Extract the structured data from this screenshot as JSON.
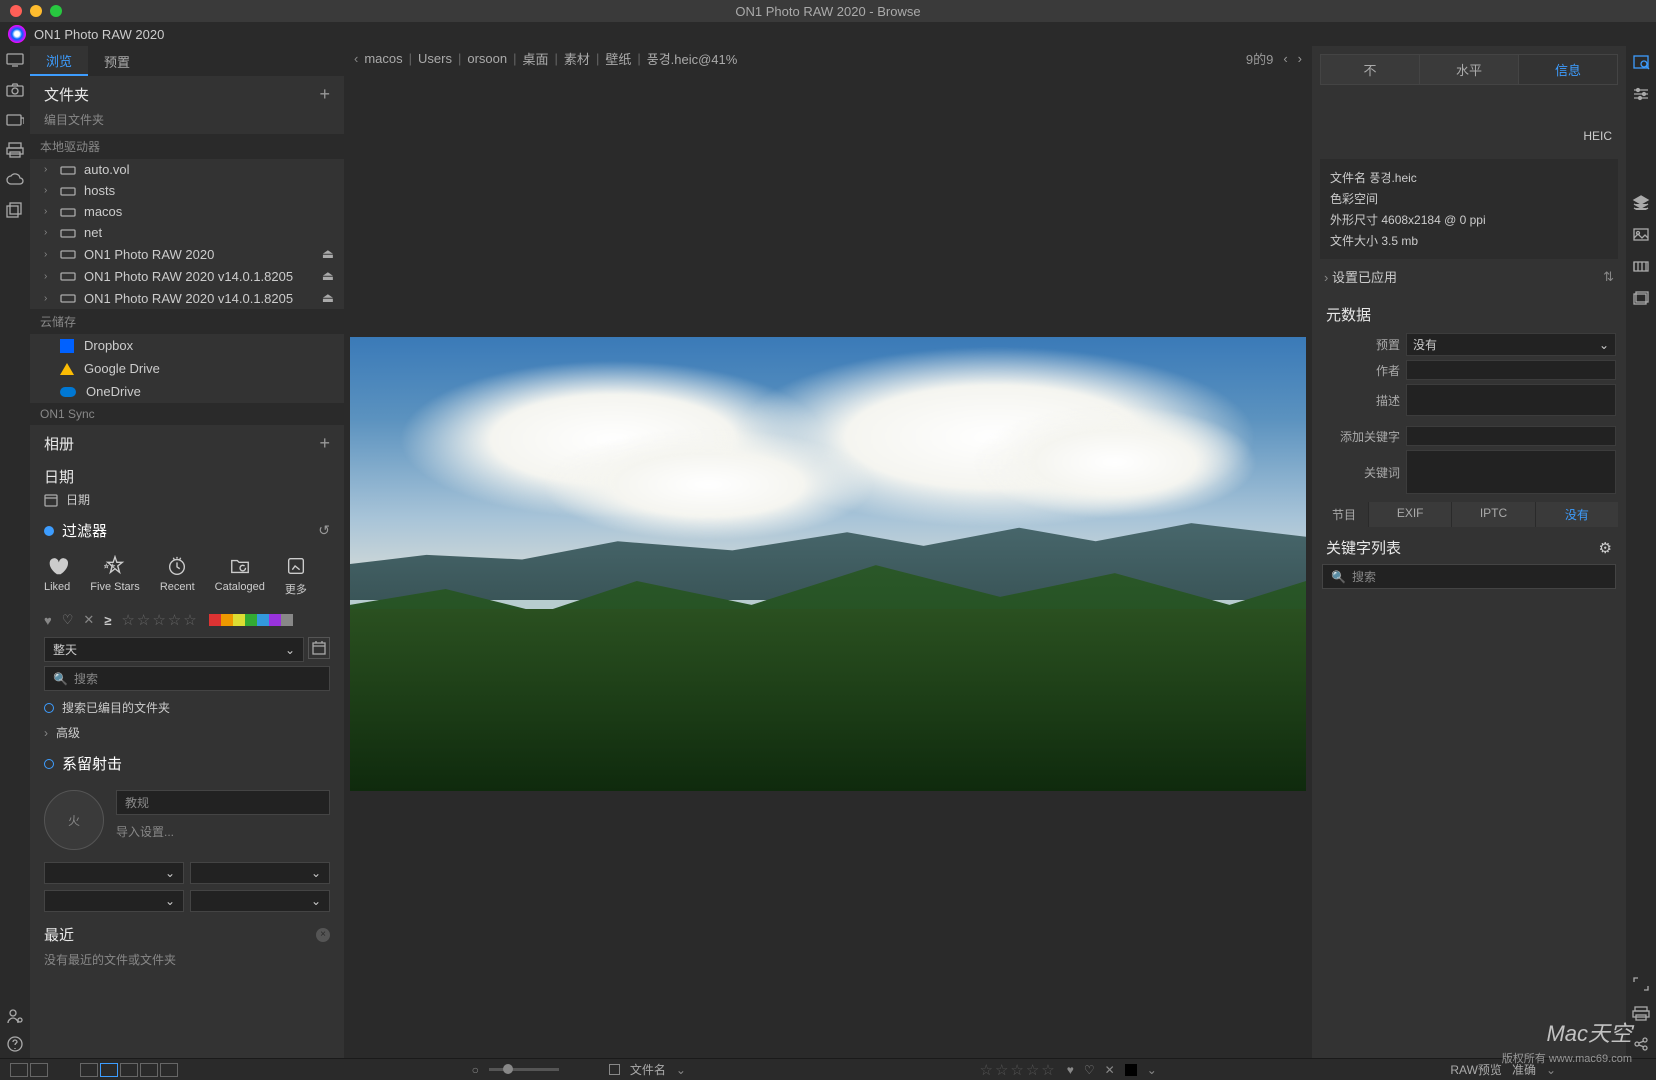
{
  "window": {
    "title": "ON1 Photo RAW 2020 - Browse",
    "app_name": "ON1 Photo RAW 2020"
  },
  "left_tabs": {
    "browse": "浏览",
    "presets": "预置"
  },
  "folders": {
    "header": "文件夹",
    "catalog": "编目文件夹",
    "local_group": "本地驱动器",
    "items": [
      "auto.vol",
      "hosts",
      "macos",
      "net",
      "ON1 Photo RAW 2020",
      "ON1 Photo RAW 2020 v14.0.1.8205",
      "ON1 Photo RAW 2020 v14.0.1.8205"
    ],
    "cloud_group": "云储存",
    "cloud_items": [
      "Dropbox",
      "Google Drive",
      "OneDrive"
    ],
    "sync_group": "ON1 Sync"
  },
  "albums": {
    "header": "相册"
  },
  "dates": {
    "header": "日期",
    "item": "日期"
  },
  "filters": {
    "header": "过滤器",
    "liked": "Liked",
    "five_stars": "Five Stars",
    "recent": "Recent",
    "cataloged": "Cataloged",
    "more": "更多",
    "time_dropdown": "整天",
    "search_placeholder": "搜索",
    "search_cataloged": "搜索已编目的文件夹",
    "advanced": "高级"
  },
  "tether": {
    "header": "系留射击",
    "fire": "火",
    "rules": "教规",
    "import_settings": "导入设置..."
  },
  "recent": {
    "header": "最近",
    "empty": "没有最近的文件或文件夹"
  },
  "breadcrumbs": {
    "items": [
      "macos",
      "Users",
      "orsoon",
      "桌面",
      "素材",
      "壁纸",
      "풍경.heic@41%"
    ],
    "counter": "9的9"
  },
  "right_tabs": {
    "none": "不",
    "level": "水平",
    "info": "信息"
  },
  "file_format": "HEIC",
  "file_info": {
    "name_label": "文件名",
    "name_value": "풍경.heic",
    "colorspace_label": "色彩空间",
    "dims_label": "外形尺寸",
    "dims_value": "4608x2184 @ 0 ppi",
    "size_label": "文件大小",
    "size_value": "3.5 mb",
    "settings_applied": "设置已应用"
  },
  "metadata": {
    "header": "元数据",
    "preset_label": "预置",
    "preset_value": "没有",
    "author_label": "作者",
    "desc_label": "描述",
    "add_kw_label": "添加关键字",
    "kw_label": "关键词",
    "tabs": {
      "program": "节目",
      "exif": "EXIF",
      "iptc": "IPTC",
      "none": "没有"
    }
  },
  "keywords": {
    "header": "关键字列表",
    "search_placeholder": "搜索"
  },
  "footer": {
    "filename_label": "文件名",
    "raw_preview": "RAW预览",
    "accurate": "准确"
  },
  "watermark": {
    "brand": "Mac天空",
    "rights": "版权所有  www.mac69.com"
  }
}
